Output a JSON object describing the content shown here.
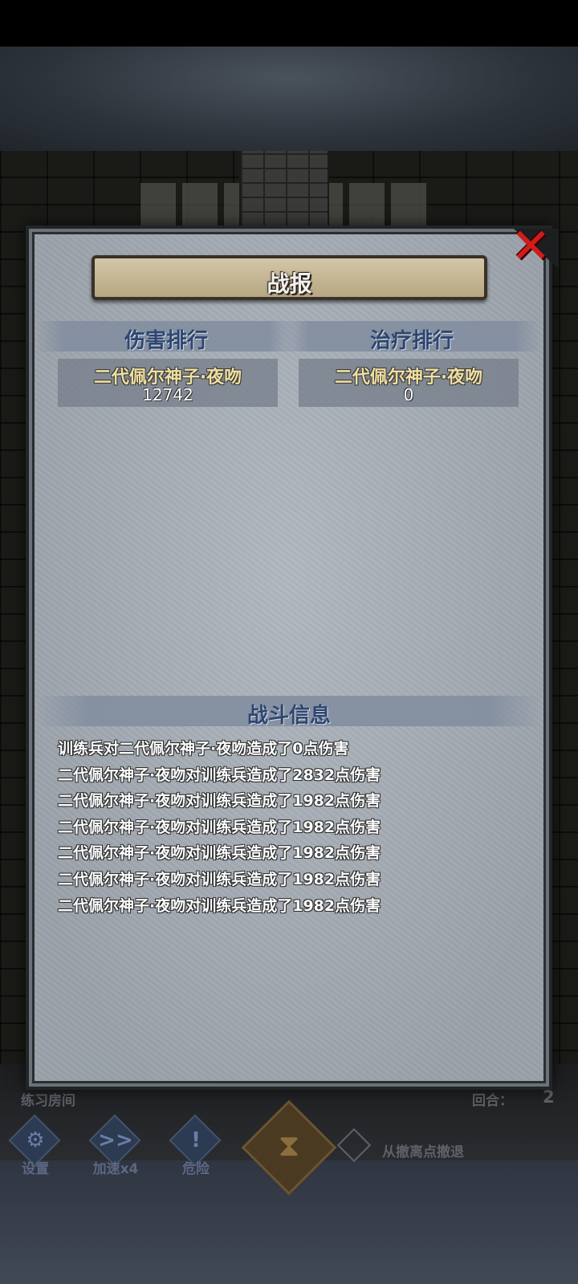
{
  "hud": {
    "room_label": "练习房间",
    "round_label": "回合：",
    "round_value": "2",
    "buttons": [
      {
        "icon": "gear-icon",
        "glyph": "⚙",
        "label": "设置"
      },
      {
        "icon": "fast-forward-icon",
        "glyph": ">>",
        "label": "加速x4"
      },
      {
        "icon": "exclamation-icon",
        "glyph": "!",
        "label": "危险"
      }
    ],
    "hourglass_glyph": "⧗",
    "retreat_label": "从撤离点撤退"
  },
  "report": {
    "title": "战报",
    "close_glyph": "✕",
    "damage_heading": "伤害排行",
    "healing_heading": "治疗排行",
    "damage_rank": [
      {
        "name": "二代佩尔神子·夜吻",
        "value": "12742"
      }
    ],
    "healing_rank": [
      {
        "name": "二代佩尔神子·夜吻",
        "value": "0"
      }
    ],
    "battle_info_heading": "战斗信息",
    "battle_log": [
      "训练兵对二代佩尔神子·夜吻造成了0点伤害",
      "二代佩尔神子·夜吻对训练兵造成了2832点伤害",
      "二代佩尔神子·夜吻对训练兵造成了1982点伤害",
      "二代佩尔神子·夜吻对训练兵造成了1982点伤害",
      "二代佩尔神子·夜吻对训练兵造成了1982点伤害",
      "二代佩尔神子·夜吻对训练兵造成了1982点伤害",
      "二代佩尔神子·夜吻对训练兵造成了1982点伤害"
    ]
  },
  "colors": {
    "close_red": "#d21c1c",
    "heading_blue": "#2e4670",
    "name_gold": "#f0dfa0"
  }
}
